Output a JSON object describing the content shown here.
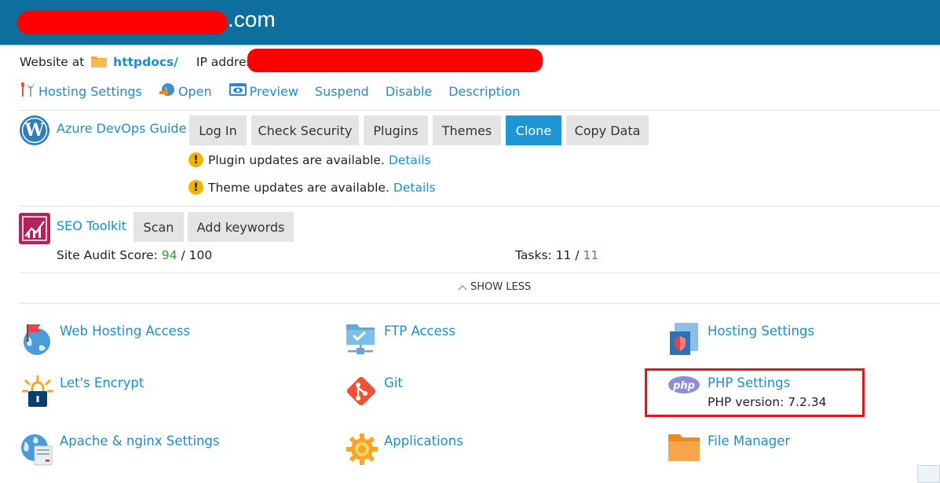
{
  "header": {
    "domain_suffix": ".com"
  },
  "info": {
    "website_at": "Website at",
    "docroot": "httpdocs/",
    "ip_label": "IP address:"
  },
  "actions": [
    {
      "label": "Hosting Settings",
      "icon": "tools-icon"
    },
    {
      "label": "Open",
      "icon": "globe-arrow-icon"
    },
    {
      "label": "Preview",
      "icon": "eye-icon"
    },
    {
      "label": "Suspend"
    },
    {
      "label": "Disable"
    },
    {
      "label": "Description"
    }
  ],
  "wordpress": {
    "name": "Azure DevOps Guide",
    "buttons": [
      "Log In",
      "Check Security",
      "Plugins",
      "Themes",
      "Clone",
      "Copy Data"
    ],
    "notices": [
      {
        "text": "Plugin updates are available.",
        "link": "Details"
      },
      {
        "text": "Theme updates are available.",
        "link": "Details"
      }
    ]
  },
  "seo": {
    "name": "SEO Toolkit",
    "buttons": [
      "Scan",
      "Add keywords"
    ],
    "audit_label": "Site Audit Score:",
    "audit_score": "94",
    "audit_total": " / 100",
    "tasks_label": "Tasks:",
    "tasks_done": " 11 / ",
    "tasks_total": "11"
  },
  "show_less": "SHOW LESS",
  "tools": {
    "web_hosting_access": "Web Hosting Access",
    "ftp_access": "FTP Access",
    "hosting_settings": "Hosting Settings",
    "lets_encrypt": "Let's Encrypt",
    "git": "Git",
    "php_settings": "PHP Settings",
    "php_version": "PHP version: 7.2.34",
    "apache_nginx": "Apache & nginx Settings",
    "applications": "Applications",
    "file_manager": "File Manager"
  },
  "colors": {
    "header_bg": "#0e6f9e",
    "link": "#1a8ed0",
    "primary_button": "#1e96d4",
    "highlight": "#e8121c",
    "redaction": "#ff0000"
  }
}
